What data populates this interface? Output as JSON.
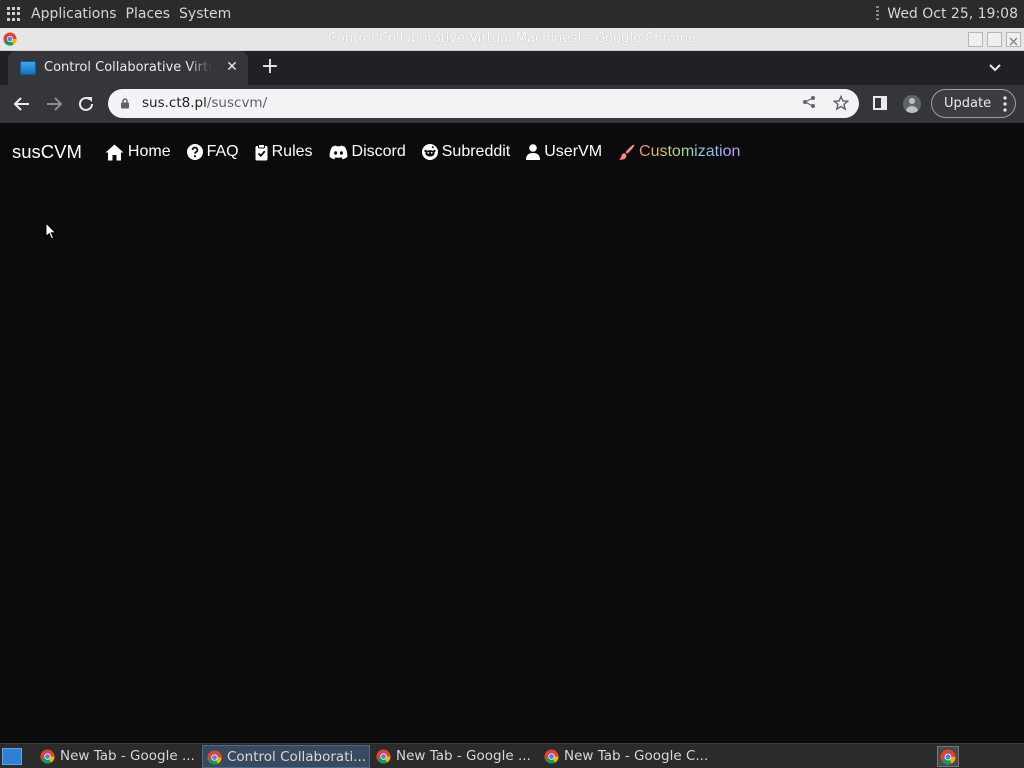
{
  "top_panel": {
    "menus": [
      "Applications",
      "Places",
      "System"
    ],
    "clock": "Wed Oct 25, 19:08"
  },
  "window": {
    "title": "Control Collaborative Virtual Machines! - Google Chrome"
  },
  "tab": {
    "title": "Control Collaborative Virtual Machines!",
    "close": "✕",
    "new_tab": "+"
  },
  "toolbar": {
    "url_host": "sus.ct8.pl",
    "url_path": "/suscvm/",
    "update_label": "Update"
  },
  "site_nav": {
    "brand": "susCVM",
    "links": [
      {
        "label": "Home",
        "icon": "home-icon"
      },
      {
        "label": "FAQ",
        "icon": "question-circle-icon"
      },
      {
        "label": "Rules",
        "icon": "clipboard-check-icon"
      },
      {
        "label": "Discord",
        "icon": "discord-icon"
      },
      {
        "label": "Subreddit",
        "icon": "reddit-icon"
      },
      {
        "label": "UserVM",
        "icon": "user-icon"
      },
      {
        "label": "Customization",
        "icon": "paintbrush-icon"
      }
    ]
  },
  "taskbar": {
    "tasks": [
      {
        "label": "New Tab - Google ..."
      },
      {
        "label": "Control Collaborati...",
        "active": true
      },
      {
        "label": "New Tab - Google ..."
      },
      {
        "label": "New Tab - Google C..."
      }
    ]
  },
  "colors": {
    "page_background": "#0b0b0b",
    "browser_frame": "#35363a",
    "tabstrip": "#202124",
    "panel": "#2b2b2b"
  }
}
